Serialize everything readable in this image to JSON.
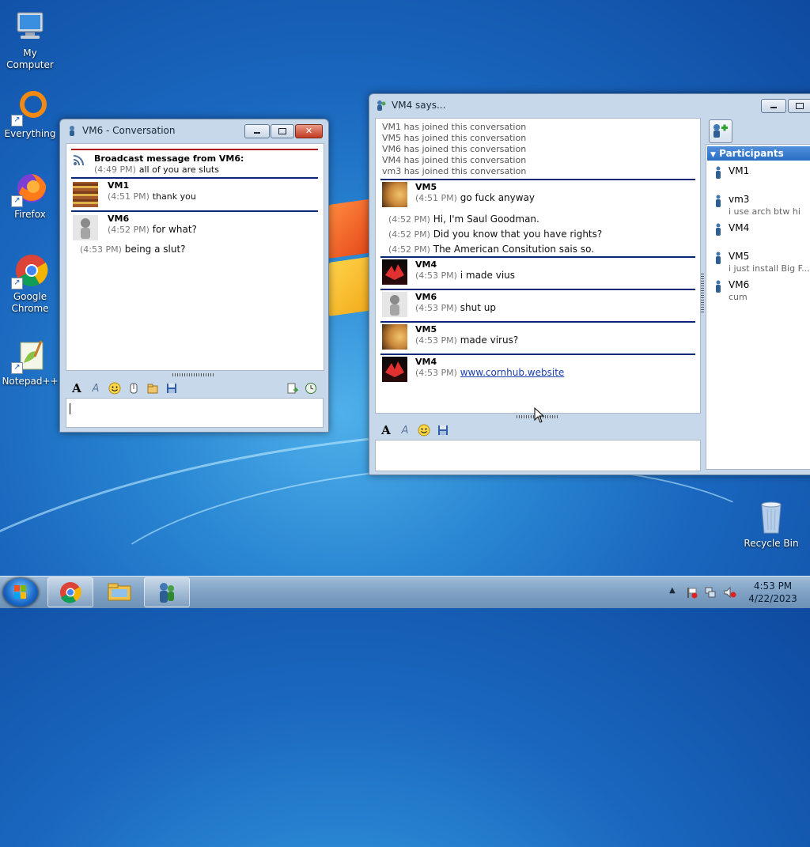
{
  "desktop": {
    "icons": [
      {
        "label": "My Computer"
      },
      {
        "label": "Everything"
      },
      {
        "label": "Firefox"
      },
      {
        "label": "Google Chrome"
      },
      {
        "label": "Notepad++"
      },
      {
        "label": "Recycle Bin"
      }
    ]
  },
  "win1": {
    "title": "VM6 - Conversation",
    "broadcast": {
      "title": "Broadcast message from VM6:",
      "time": "(4:49 PM)",
      "text": "all of you are sluts"
    },
    "messages": [
      {
        "name": "VM1",
        "time": "(4:51 PM)",
        "text": "thank you"
      },
      {
        "name": "VM6",
        "time": "(4:52 PM)",
        "text": "for what?"
      }
    ],
    "followup": {
      "time": "(4:53 PM)",
      "text": "being a slut?"
    }
  },
  "win2": {
    "title": "VM4 says...",
    "system_lines": [
      "VM1 has joined this conversation",
      "VM5 has joined this conversation",
      "VM6 has joined this conversation",
      "VM4 has joined this conversation",
      "vm3 has joined this conversation"
    ],
    "msg1": {
      "name": "VM5",
      "time": "(4:51 PM)",
      "text": "go fuck anyway"
    },
    "msg1_extra": [
      {
        "time": "(4:52 PM)",
        "text": "Hi, I'm Saul Goodman."
      },
      {
        "time": "(4:52 PM)",
        "text": "Did you know that you have rights?"
      },
      {
        "time": "(4:52 PM)",
        "text": "The American Consitution sais so."
      }
    ],
    "msg2": {
      "name": "VM4",
      "time": "(4:53 PM)",
      "text": "i made vius"
    },
    "msg3": {
      "name": "VM6",
      "time": "(4:53 PM)",
      "text": "shut up"
    },
    "msg4": {
      "name": "VM5",
      "time": "(4:53 PM)",
      "text": "made virus?"
    },
    "msg5": {
      "name": "VM4",
      "time": "(4:53 PM)",
      "link": "www.cornhub.website"
    },
    "participants_header": "Participants",
    "participants": [
      {
        "name": "VM1",
        "status": ""
      },
      {
        "name": "vm3",
        "status": "i use arch btw hi"
      },
      {
        "name": "VM4",
        "status": ""
      },
      {
        "name": "VM5",
        "status": "i just install Big F..."
      },
      {
        "name": "VM6",
        "status": "cum"
      }
    ]
  },
  "taskbar": {
    "time": "4:53 PM",
    "date": "4/22/2023"
  }
}
